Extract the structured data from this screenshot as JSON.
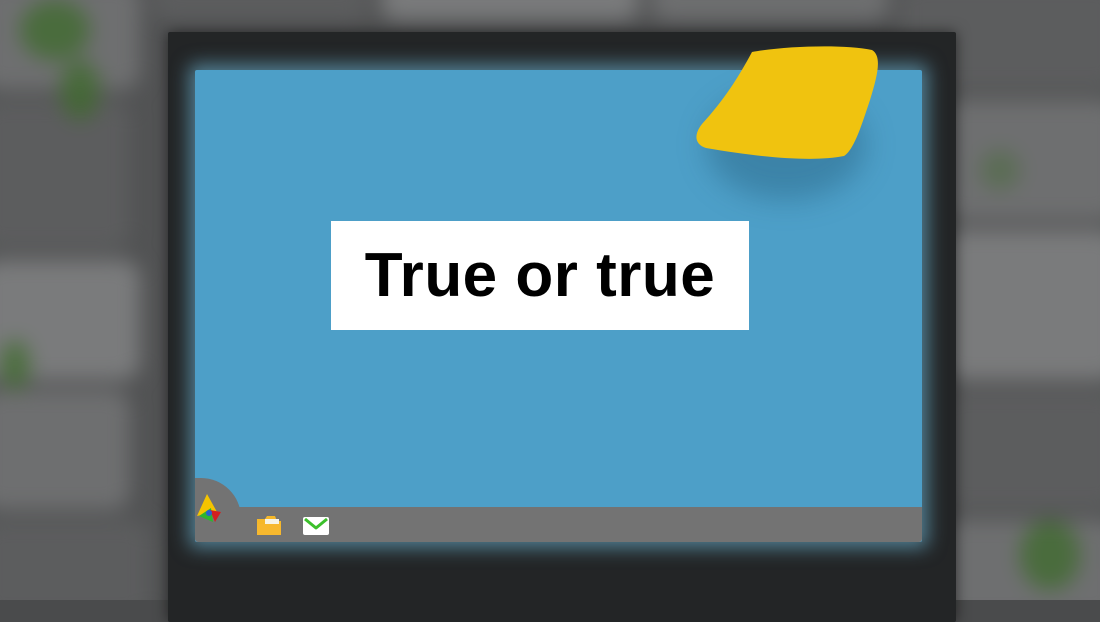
{
  "screen": {
    "message": "True or true"
  },
  "taskbar": {
    "start_icon": "triangle-logo-icon",
    "apps": [
      {
        "icon": "folder-icon"
      },
      {
        "icon": "mail-icon"
      }
    ]
  },
  "desktop": {
    "sticky_note": "sticky-note"
  },
  "colors": {
    "screen": "#4d9fc8",
    "taskbar": "#737373",
    "sticky_note": "#f0c30f",
    "monitor_bezel": "#232526",
    "message_bg": "#ffffff",
    "message_text": "#000000"
  }
}
